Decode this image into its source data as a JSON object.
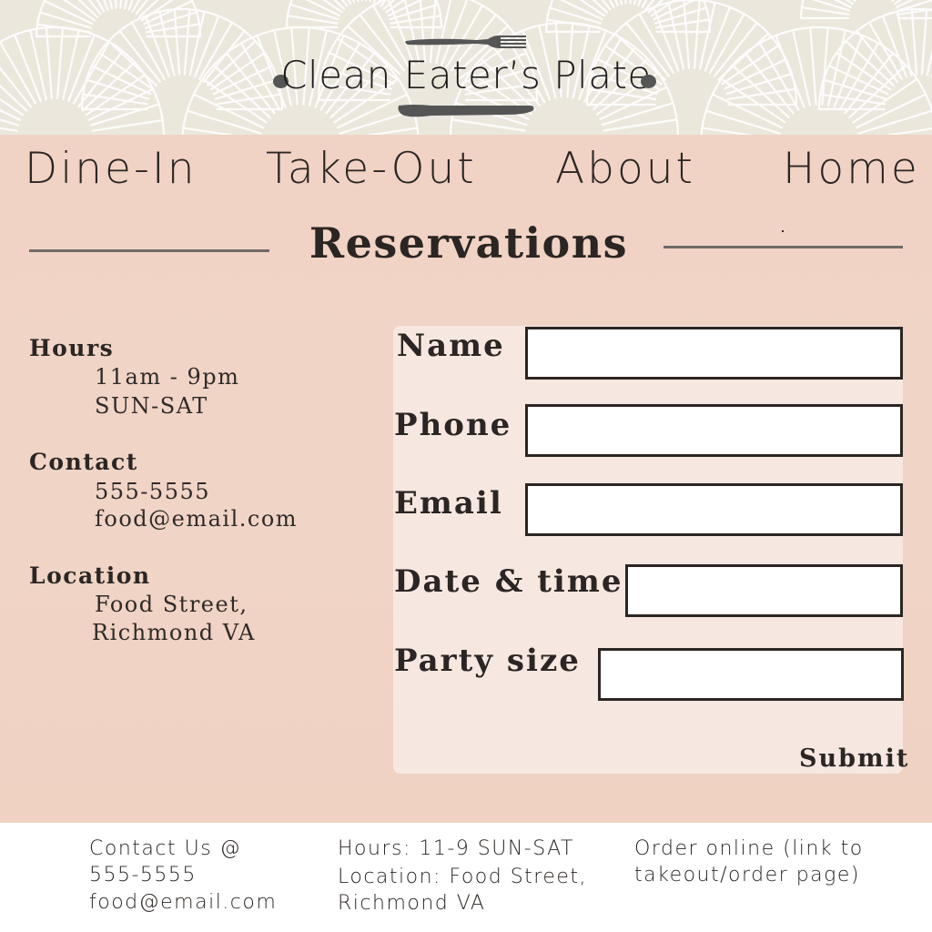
{
  "brand": {
    "name": "Clean Eater’s Plate",
    "header_bg": "#ebe7dd",
    "logo_color": "#555556"
  },
  "nav": {
    "items": [
      {
        "label": "Dine-In"
      },
      {
        "label": "Take-Out"
      },
      {
        "label": "About"
      },
      {
        "label": "Home"
      }
    ]
  },
  "page": {
    "title": "Reservations",
    "panel_color": "#f0d4c6"
  },
  "info": {
    "hours": {
      "heading": "Hours",
      "lines": [
        "11am - 9pm",
        "SUN-SAT"
      ]
    },
    "contact": {
      "heading": "Contact",
      "lines": [
        "555-5555",
        "food@email.com"
      ]
    },
    "location": {
      "heading": "Location",
      "lines": [
        "Food Street,",
        "Richmond VA"
      ]
    }
  },
  "form": {
    "card_color": "#f6e8e0",
    "fields": [
      {
        "label": "Name",
        "value": ""
      },
      {
        "label": "Phone",
        "value": ""
      },
      {
        "label": "Email",
        "value": ""
      },
      {
        "label": "Date & time",
        "value": ""
      },
      {
        "label": "Party size",
        "value": ""
      }
    ],
    "submit_label": "Submit"
  },
  "footer": {
    "contact": [
      "Contact Us @",
      "555-5555",
      "food@email.com"
    ],
    "hours": [
      "Hours: 11-9 SUN-SAT",
      "Location: Food Street,",
      "Richmond VA"
    ],
    "order": [
      "Order online (link to",
      "takeout/order page)"
    ]
  }
}
